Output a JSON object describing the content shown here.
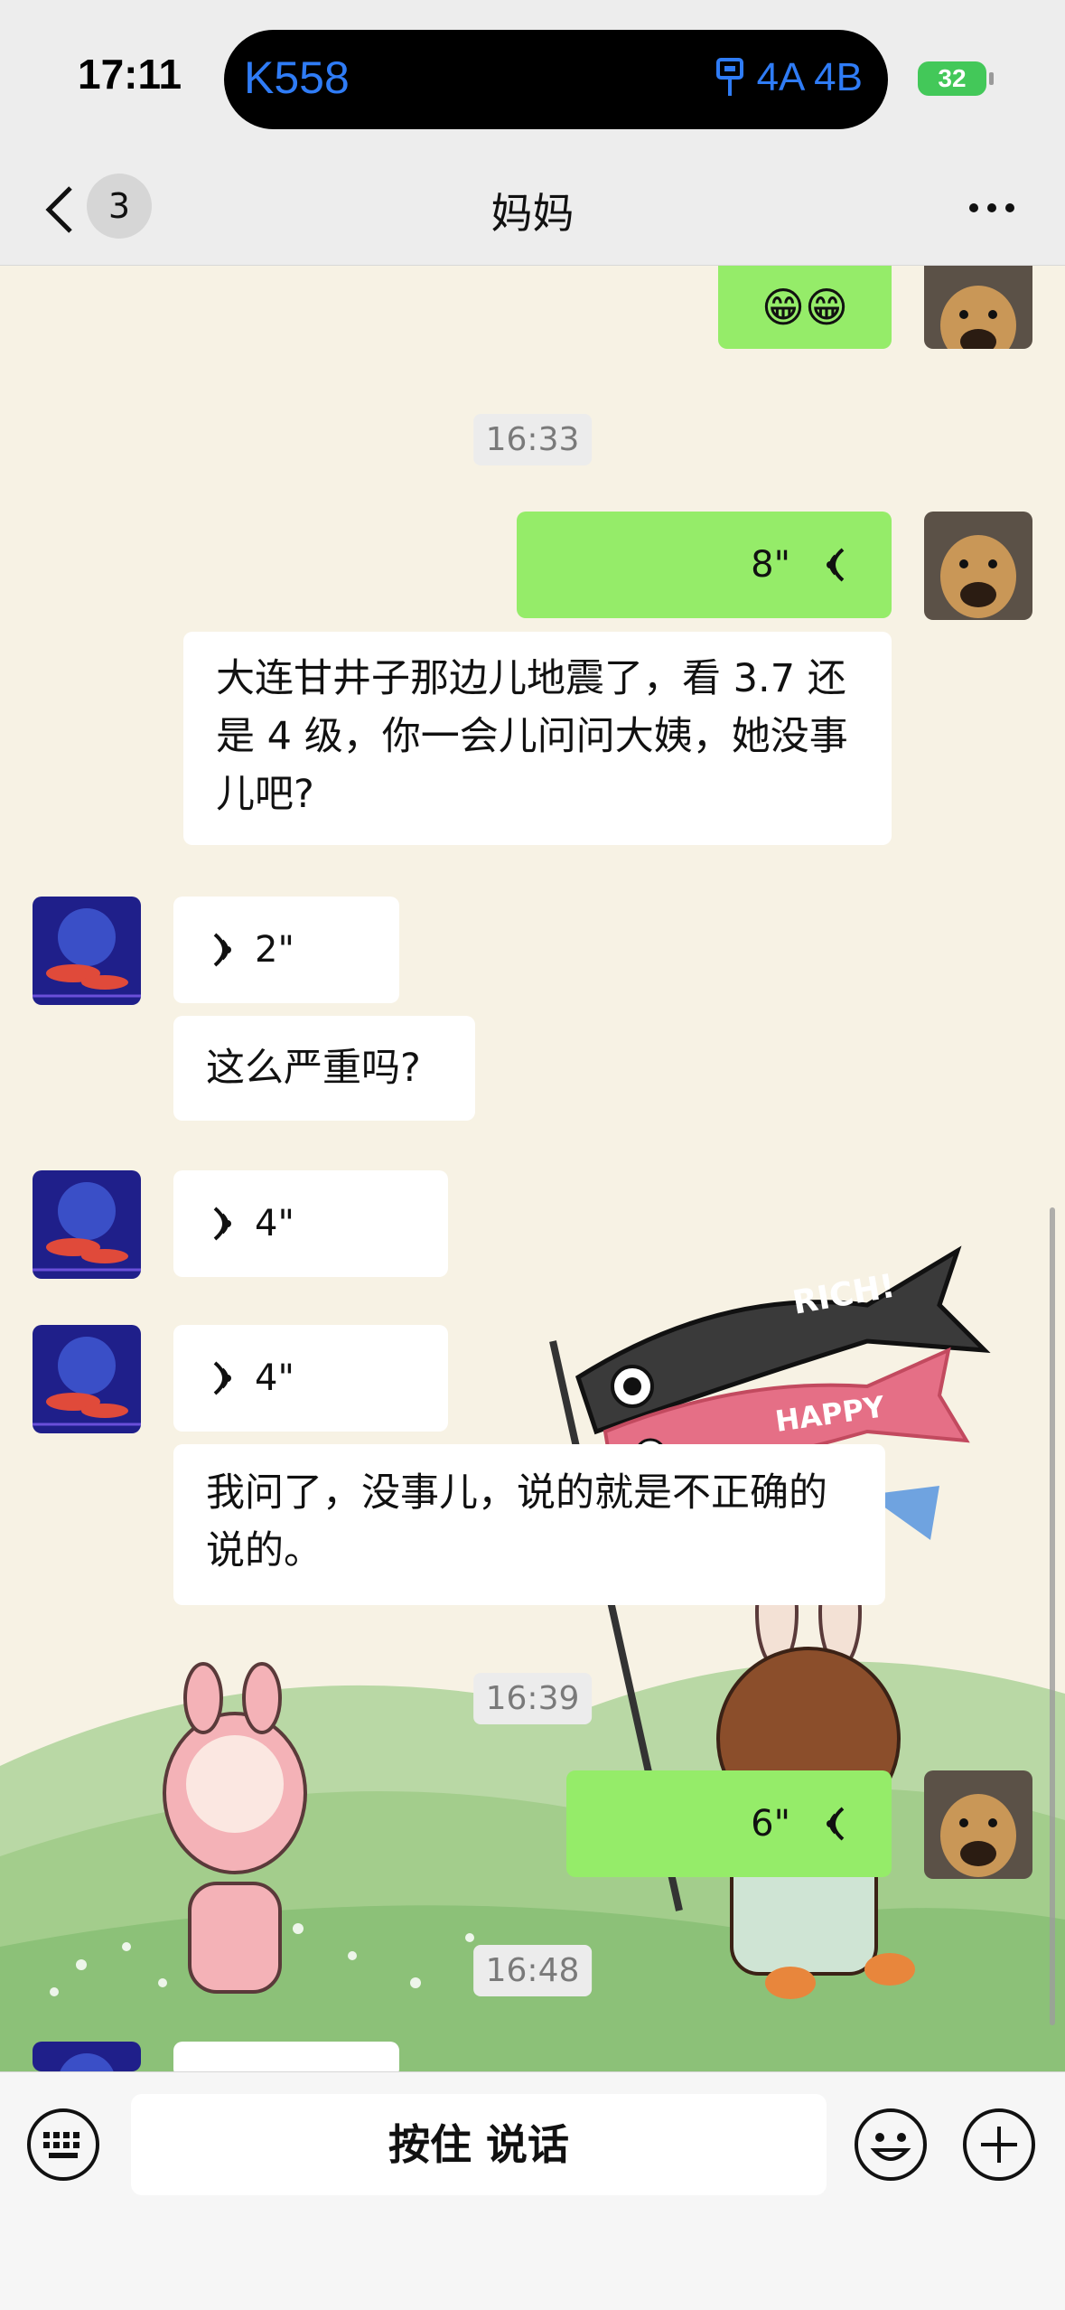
{
  "status_bar": {
    "time": "17:11",
    "island_route": "K558",
    "island_stops": "4A 4B",
    "battery": "32"
  },
  "nav": {
    "unread_count": "3",
    "title": "妈妈"
  },
  "messages": {
    "m1_emoji": "😁😁",
    "time1": "16:33",
    "voice1": "8\"",
    "text1": "大连甘井子那边儿地震了，看 3.7 还是 4 级，你一会儿问问大姨，她没事儿吧?",
    "voice2": "2\"",
    "text2": "这么严重吗?",
    "voice3": "4\"",
    "voice4": "4\"",
    "text3": "我问了，没事儿，说的就是不正确的说的。",
    "time2": "16:39",
    "voice5": "6\"",
    "time3": "16:48"
  },
  "sticker_text": {
    "fish1": "RICH!",
    "fish2": "HAPPY"
  },
  "input": {
    "talk_label": "按住 说话"
  },
  "colors": {
    "outgoing_bubble": "#95ec69",
    "incoming_bubble": "#ffffff",
    "island_accent": "#2f7cf6",
    "battery": "#43c859"
  }
}
